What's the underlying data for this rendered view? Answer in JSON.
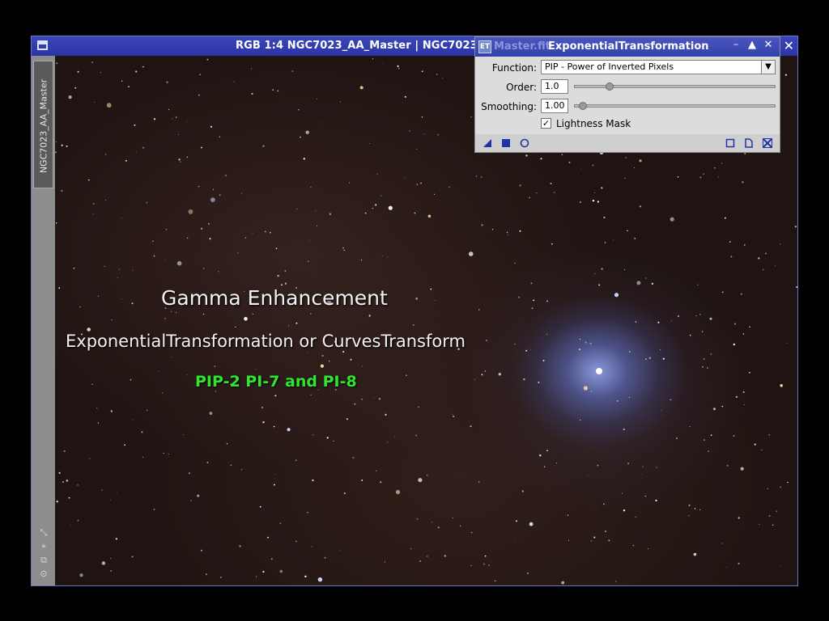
{
  "window": {
    "title": "RGB 1:4 NGC7023_AA_Master | NGC7023_",
    "close_glyph": "✕",
    "view_tab": "NGC7023_AA_Master"
  },
  "image_overlay": {
    "line1": "Gamma Enhancement",
    "line2": "ExponentialTransformation or CurvesTransform",
    "line3": "PIP-2 PI-7 and PI-8",
    "line3_color": "#2ee62e"
  },
  "dialog": {
    "title_shadow": "Master.fit",
    "title": "ExponentialTransformation",
    "icon_glyph": "ET",
    "btn_minimize": "–",
    "btn_shade": "▲",
    "btn_close": "✕",
    "function_label": "Function:",
    "function_value": "PIP - Power of Inverted Pixels",
    "order_label": "Order:",
    "order_value": "1.0",
    "order_fraction": 0.16,
    "smoothing_label": "Smoothing:",
    "smoothing_value": "1.00",
    "smoothing_fraction": 0.02,
    "lightness_mask_label": "Lightness Mask",
    "lightness_mask_checked": true,
    "check_glyph": "✓"
  },
  "sidebar_icons": [
    "expand-icon",
    "fit-icon",
    "clone-icon",
    "settings-icon"
  ],
  "colors": {
    "titlebar": "#2f39a9",
    "dialog_bg": "#dcdcdc",
    "bottom_icon": "#2233aa"
  }
}
